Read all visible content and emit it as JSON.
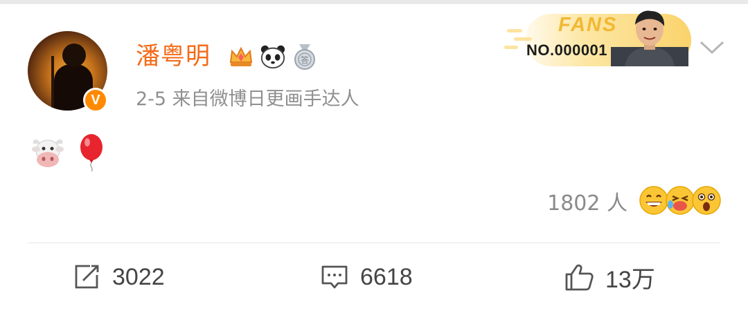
{
  "post": {
    "username": "潘粤明",
    "meta": "2-5  来自微博日更画手达人",
    "verified_badge": "V",
    "user_badges": [
      "crown-badge-icon",
      "panda-badge-icon",
      "medal-badge-icon"
    ],
    "content_emojis": [
      "cow-face-emoji",
      "red-balloon-emoji"
    ]
  },
  "fans_card": {
    "label": "FANS",
    "number": "NO.000001"
  },
  "reactions": {
    "count": "1802 人",
    "faces": [
      "grinning-face-icon",
      "laughing-tears-face-icon",
      "surprised-face-icon"
    ]
  },
  "actions": {
    "repost": {
      "icon": "repost-icon",
      "count": "3022"
    },
    "comment": {
      "icon": "comment-icon",
      "count": "6618"
    },
    "like": {
      "icon": "thumbs-up-icon",
      "count": "13万"
    }
  },
  "colors": {
    "username": "#f46a17",
    "meta": "#8f8f8f",
    "accent_gold": "#fbd36b",
    "action_text": "#444444"
  }
}
